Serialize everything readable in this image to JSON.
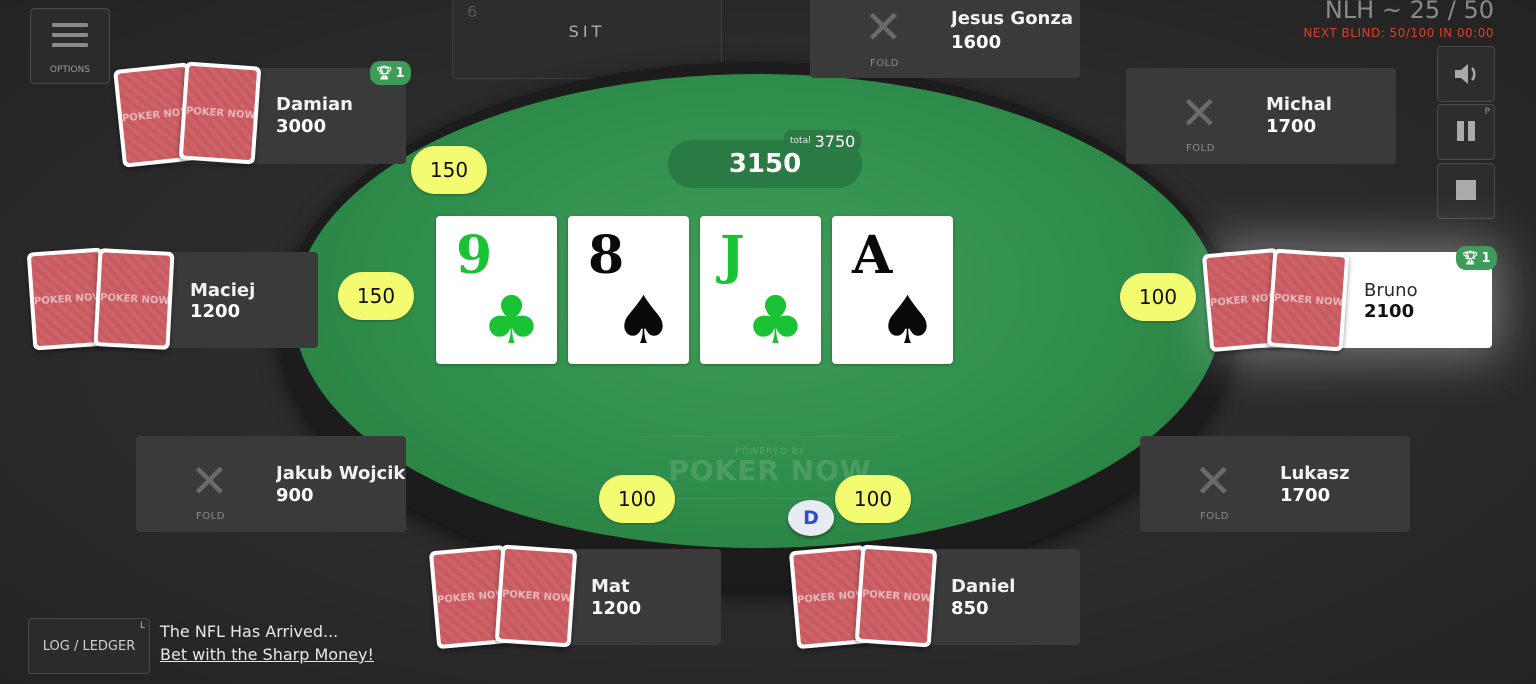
{
  "header": {
    "game_title": "NLH ~ 25 / 50",
    "next_blind": "NEXT BLIND: 50/100 IN 00:00"
  },
  "menu": {
    "label": "OPTIONS",
    "icon": "hamburger-menu-icon"
  },
  "open_seat": {
    "number": "6",
    "label": "SIT"
  },
  "controls": {
    "sound_icon": "speaker-icon",
    "pause_icon": "pause-icon",
    "pause_hint": "P",
    "stop_icon": "stop-icon"
  },
  "pot": {
    "value": "3150",
    "total_label": "total",
    "total_value": "3750"
  },
  "board": [
    {
      "rank": "9",
      "suit": "♣",
      "suit_name": "clubs",
      "color": "#19c232"
    },
    {
      "rank": "8",
      "suit": "♠",
      "suit_name": "spades",
      "color": "#0a0a0a"
    },
    {
      "rank": "J",
      "suit": "♣",
      "suit_name": "clubs",
      "color": "#19c232"
    },
    {
      "rank": "A",
      "suit": "♠",
      "suit_name": "spades",
      "color": "#0a0a0a"
    }
  ],
  "card_back_logo": "POKER NOW",
  "felt": {
    "powered_by": "POWERED BY",
    "brand": "POKER NOW"
  },
  "players": {
    "jesus": {
      "name": "Jesus Gonzalez",
      "stack": "1600",
      "status": "FOLD"
    },
    "damian": {
      "name": "Damian",
      "stack": "3000",
      "badge": "1",
      "bet": "150"
    },
    "michal": {
      "name": "Michal",
      "stack": "1700",
      "status": "FOLD"
    },
    "maciej": {
      "name": "Maciej",
      "stack": "1200",
      "bet": "150"
    },
    "bruno": {
      "name": "Bruno",
      "stack": "2100",
      "badge": "1",
      "bet": "100"
    },
    "jakub": {
      "name": "Jakub Wojcik",
      "stack": "900",
      "status": "FOLD"
    },
    "lukasz": {
      "name": "Lukasz",
      "stack": "1700",
      "status": "FOLD"
    },
    "mat": {
      "name": "Mat",
      "stack": "1200",
      "bet": "100"
    },
    "daniel": {
      "name": "Daniel",
      "stack": "850",
      "bet": "100"
    }
  },
  "dealer_button": "D",
  "footer": {
    "log_label": "LOG / LEDGER",
    "log_hint": "L",
    "promo_text": "The NFL Has Arrived...",
    "promo_link": "Bet with the Sharp Money!"
  },
  "colors": {
    "felt": "#2f8d4b",
    "chip": "#f3fb70",
    "card_back": "#c75a60",
    "blind_warning": "#d6412d",
    "badge": "#3e9b5a"
  }
}
